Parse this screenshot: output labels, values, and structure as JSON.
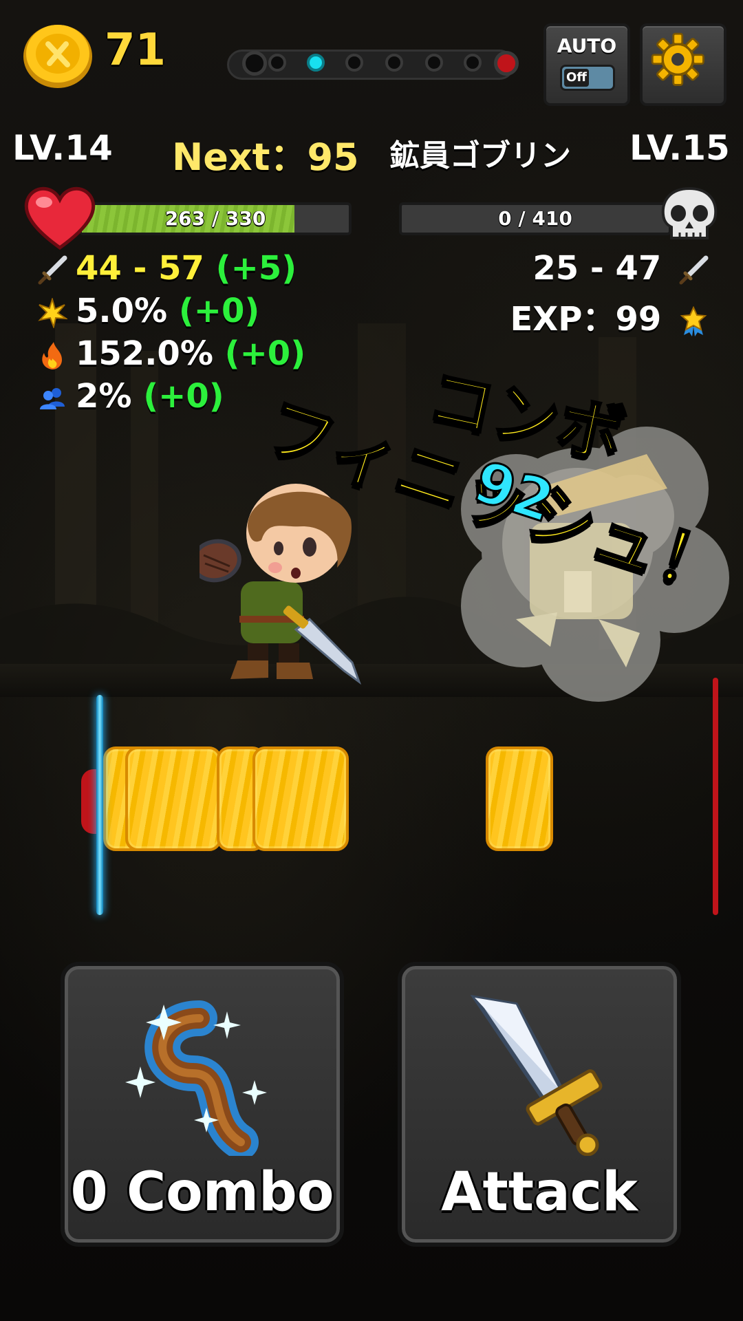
{
  "hud": {
    "coins": "71",
    "auto_label": "AUTO",
    "auto_state": "Off",
    "stage_dots": [
      "empty",
      "empty",
      "current",
      "empty",
      "empty",
      "empty",
      "empty",
      "boss"
    ]
  },
  "player": {
    "level": "LV.14",
    "next_exp": "Next：95",
    "hp": {
      "text": "263 / 330",
      "current": 263,
      "max": 330
    },
    "attack_parts": [
      "44 - 57",
      "(+5)"
    ],
    "crit_parts": [
      "5.0%",
      "(+0)"
    ],
    "crit_damage_parts": [
      "152.0%",
      "(+0)"
    ],
    "party_parts": [
      "2%",
      "(+0)"
    ]
  },
  "enemy": {
    "name": "鉱員ゴブリン",
    "level": "LV.15",
    "hp": {
      "text": "0 / 410",
      "current": 0,
      "max": 410
    },
    "attack": "25 - 47",
    "exp": "EXP：99"
  },
  "combo_finish": {
    "line1": "コンボ",
    "line2": "フィニッシュ！",
    "number": "92"
  },
  "buttons": {
    "combo": "0 Combo",
    "attack": "Attack"
  },
  "colors": {
    "gold": "#ffd83a",
    "next": "#ffe86a",
    "bonus_green": "#2cf03c",
    "stat_yellow": "#ffef3a",
    "hp_green": "#8cc63a",
    "timing_blue": "#29b6ff",
    "note_gold": "#ffc51f"
  }
}
